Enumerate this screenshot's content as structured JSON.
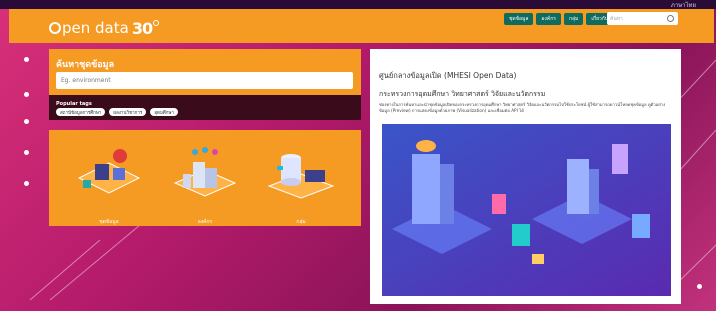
{
  "topstrip": {
    "text": "ภาษาไทย"
  },
  "header": {
    "logo_text": "pen data",
    "logo_num": "30",
    "nav_items": [
      {
        "label": "ชุดข้อมูล"
      },
      {
        "label": "องค์กร"
      },
      {
        "label": "กลุ่ม"
      },
      {
        "label": "เกี่ยวกับ"
      }
    ],
    "search_placeholder": "ค้นหา"
  },
  "search": {
    "title": "ค้นหาชุดข้อมูล",
    "placeholder": "Eg. environment",
    "popular_tags_label": "Popular tags",
    "tags": [
      "สถานีข้อมูลการศึกษา",
      "ผลงานวิชาการ",
      "อุดมศึกษา"
    ]
  },
  "categories": [
    {
      "label": "ชุดข้อมูล",
      "icon": "data-server-icon"
    },
    {
      "label": "องค์กร",
      "icon": "organization-icon"
    },
    {
      "label": "กลุ่ม",
      "icon": "group-icon"
    }
  ],
  "info": {
    "title": "ศูนย์กลางข้อมูลเปิด (MHESI Open Data)",
    "subtitle": "กระทรวงการอุดมศึกษา วิทยาศาสตร์ วิจัยและนวัตกรรม",
    "description": "ช่องทางในการค้นหาและนำชุดข้อมูลเปิดของกระทรวงการอุดมศึกษา วิทยาศาสตร์ วิจัยและนวัตกรรมไปใช้ประโยชน์ ผู้ใช้สามารถดาวน์โหลดชุดข้อมูล ดูตัวอย่างข้อมูล (Preview) การแสดงข้อมูลด้วยภาพ (Visualization) และเชื่อมต่อ API ได้"
  },
  "colors": {
    "accent": "#f59a22",
    "nav_button": "#0e6b5e",
    "background": "#b21a6a"
  }
}
